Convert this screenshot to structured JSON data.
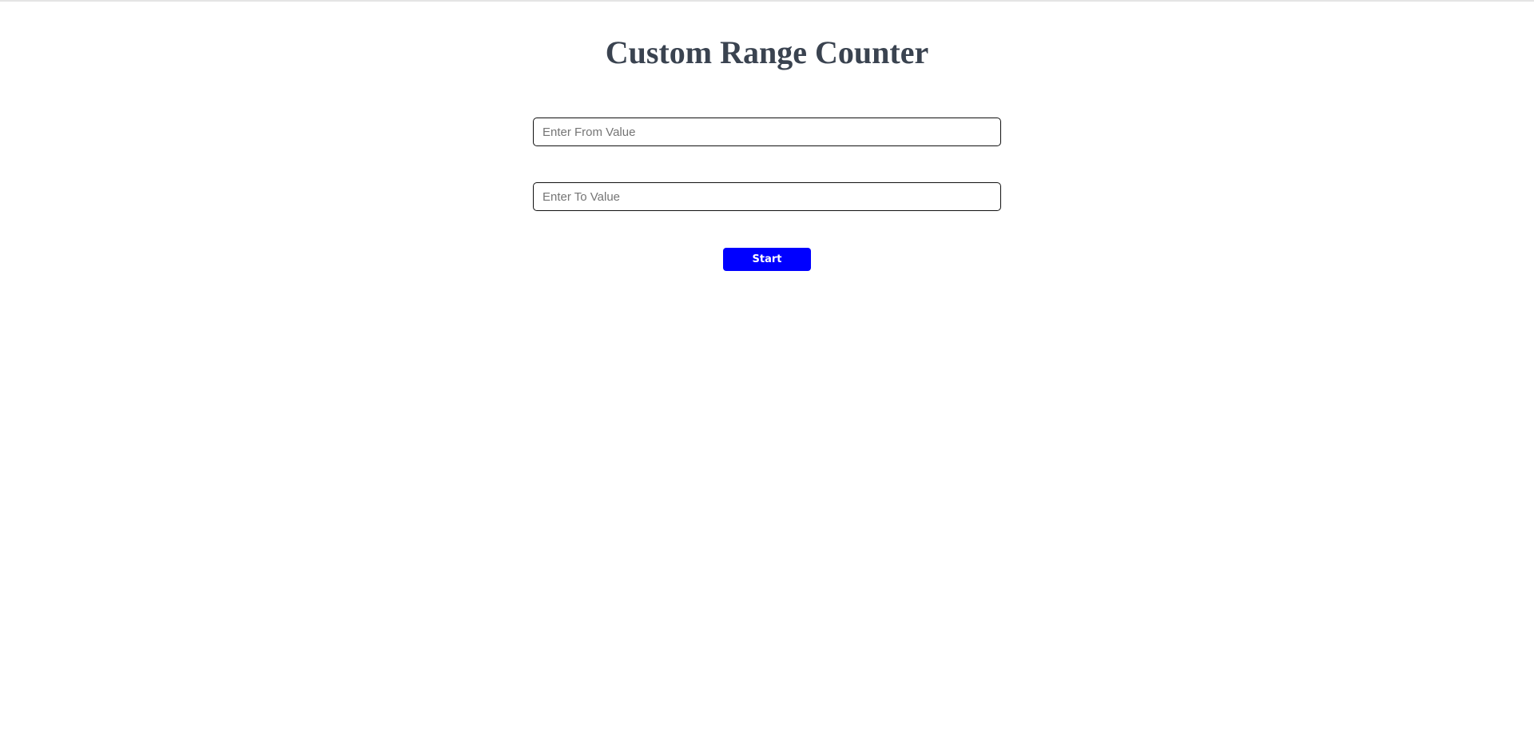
{
  "page": {
    "title": "Custom Range Counter"
  },
  "form": {
    "from_input": {
      "value": "",
      "placeholder": "Enter From Value"
    },
    "to_input": {
      "value": "",
      "placeholder": "Enter To Value"
    },
    "start_label": "Start"
  },
  "colors": {
    "button": "#0000ff",
    "title": "#3a4350"
  }
}
